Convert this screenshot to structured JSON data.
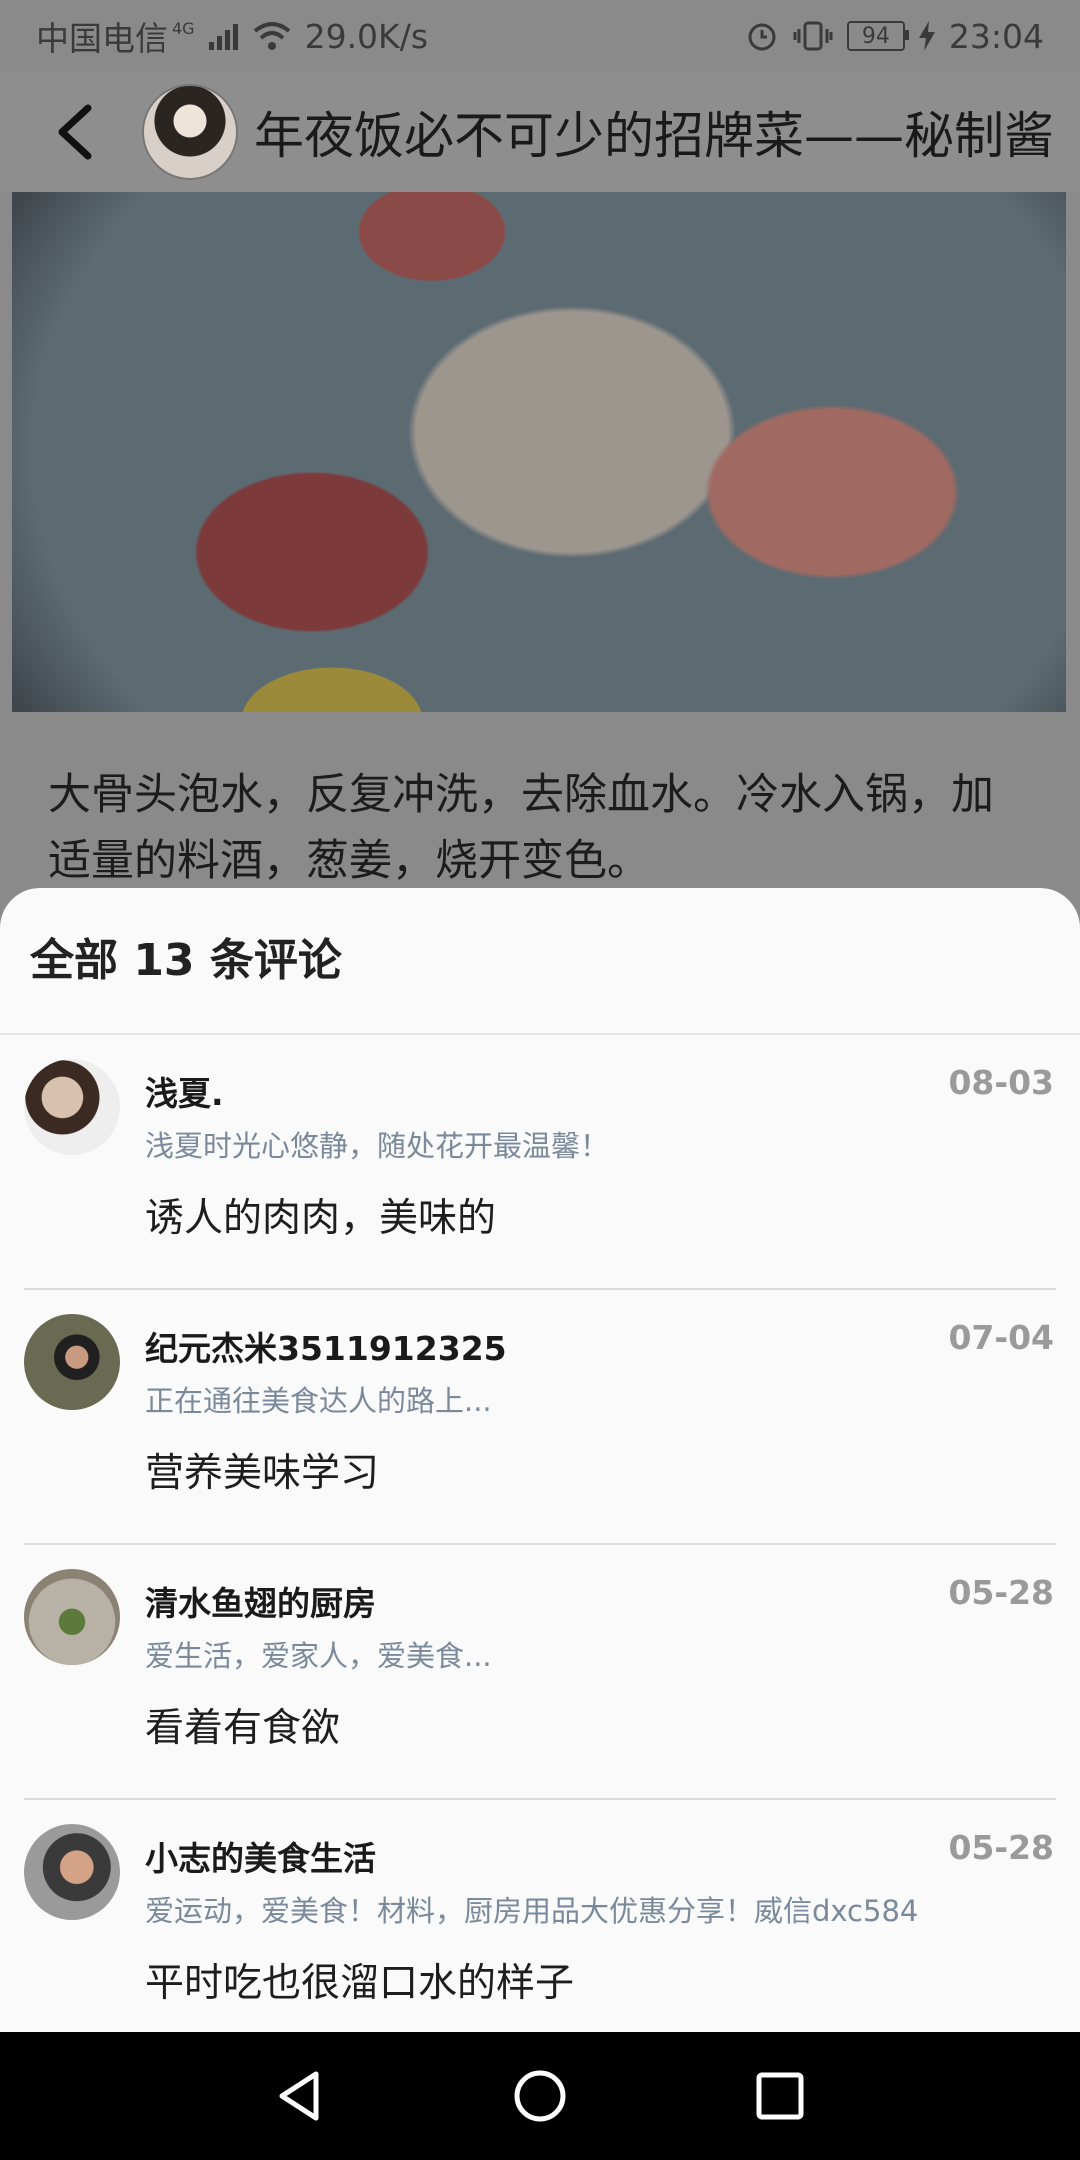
{
  "status_bar": {
    "carrier": "中国电信",
    "network": "4G",
    "speed": "29.0K/s",
    "battery": "94",
    "time": "23:04"
  },
  "header": {
    "title": "年夜饭必不可少的招牌菜——秘制酱"
  },
  "description": "大骨头泡水，反复冲洗，去除血水。冷水入锅，加适量的料酒，葱姜，烧开变色。",
  "comments_sheet": {
    "title": "全部 13 条评论",
    "comments": [
      {
        "name": "浅夏.",
        "date": "08-03",
        "signature": "浅夏时光心悠静，随处花开最温馨！",
        "text": "诱人的肉肉，美味的"
      },
      {
        "name": "纪元杰米3511912325",
        "date": "07-04",
        "signature": "正在通往美食达人的路上...",
        "text": "营养美味学习"
      },
      {
        "name": "清水鱼翅的厨房",
        "date": "05-28",
        "signature": "爱生活，爱家人，爱美食...",
        "text": "看着有食欲"
      },
      {
        "name": "小志的美食生活",
        "date": "05-28",
        "signature": "爱运动，爱美食！材料，厨房用品大优惠分享！威信dxc584",
        "text": "平时吃也很溜口水的样子"
      }
    ]
  },
  "colors": {
    "sheet_background": "#fafafa",
    "signature_text": "#7a8a9c",
    "date_text": "#9a9a9a",
    "dim_overlay": "#8a8a8a"
  }
}
